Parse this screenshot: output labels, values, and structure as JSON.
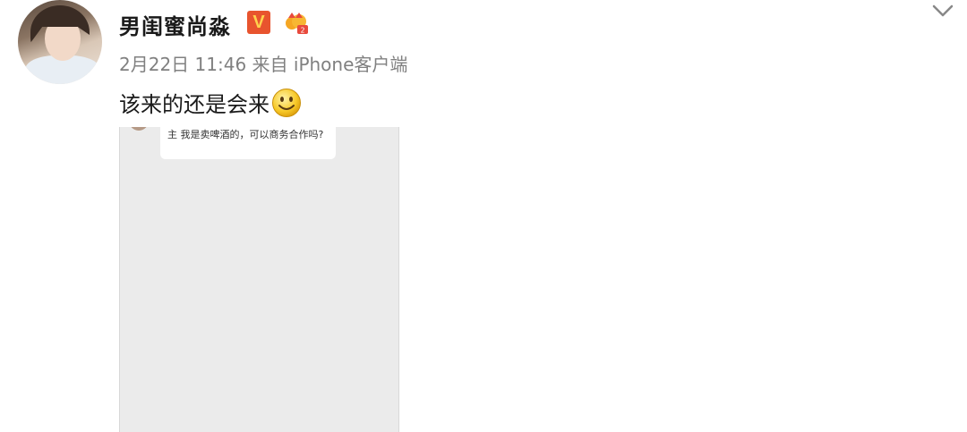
{
  "post": {
    "username": "男闺蜜尚淼",
    "verified_badge": "V",
    "crown_icon": "crown-level-icon",
    "timestamp": "2月22日 11:46",
    "source_prefix": "来自",
    "source": "iPhone客户端",
    "text": "该来的还是会来",
    "emoji": "smile-emoji-icon",
    "chevron_icon": "chevron-down-icon"
  },
  "image": {
    "bubble_text": "主 我是卖啤酒的，可以商务合作吗?"
  },
  "colors": {
    "verified_badge_bg": "#e8542e",
    "meta_text": "#808080",
    "image_bg": "#ebebeb"
  }
}
